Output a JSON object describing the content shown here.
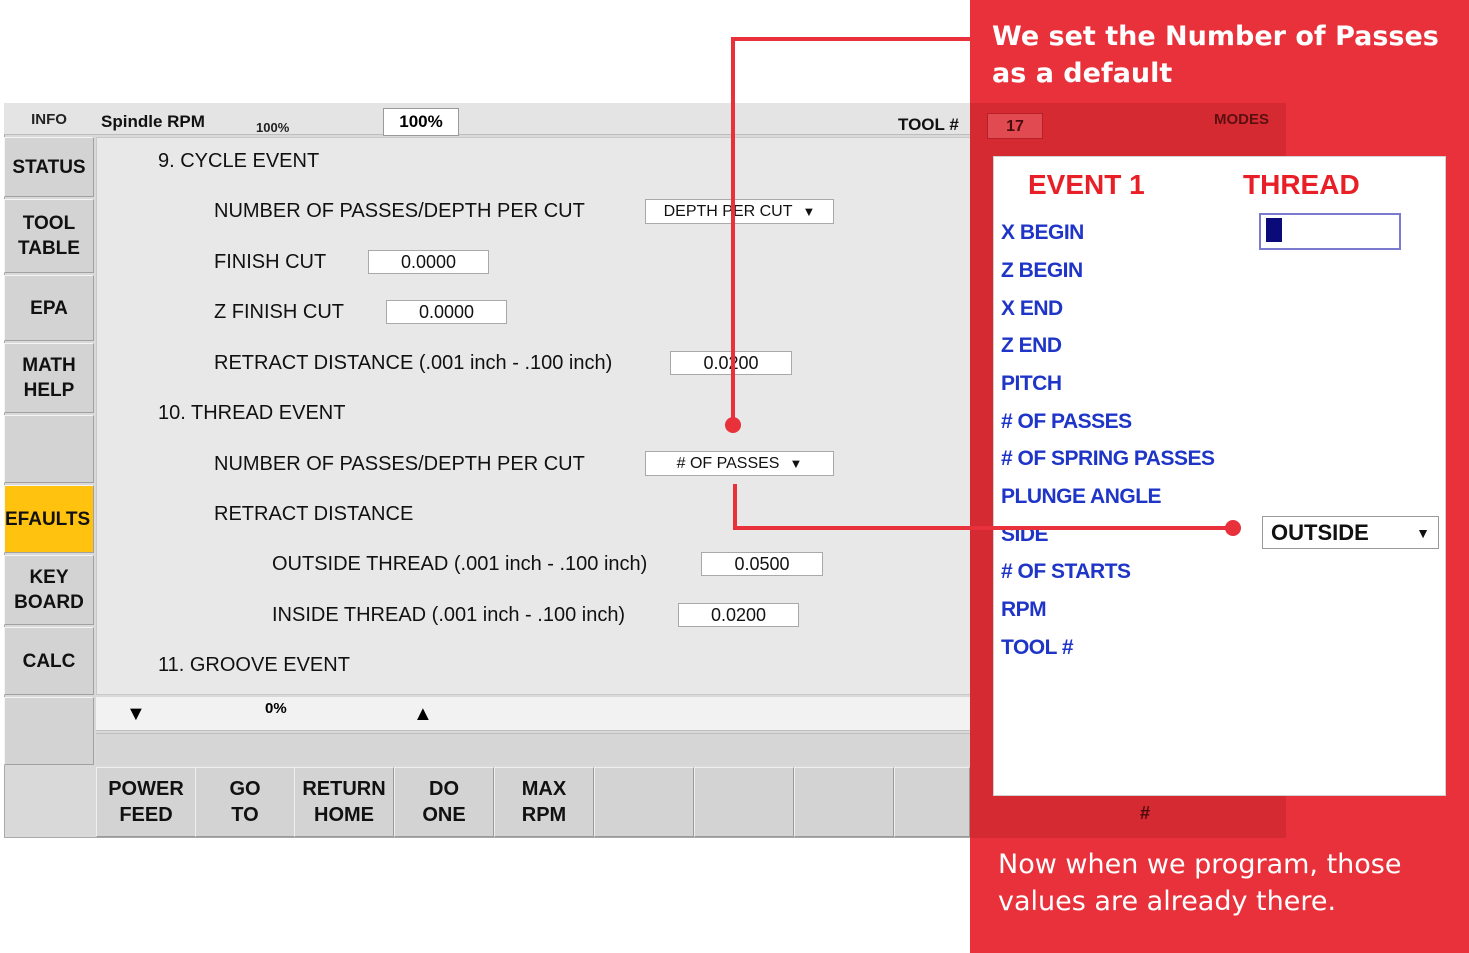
{
  "topbar": {
    "info": "INFO",
    "spindle_label": "Spindle RPM",
    "spindle_pct_small": "100%",
    "spindle_pct_box": "100%",
    "tool_label": "TOOL #",
    "tool_value": "17",
    "modes": "MODES"
  },
  "sidebar": [
    {
      "label": "STATUS"
    },
    {
      "label": "TOOL\nTABLE"
    },
    {
      "label": "EPA"
    },
    {
      "label": "MATH\nHELP"
    },
    {
      "label": ""
    },
    {
      "label": "EFAULTS",
      "active": true
    },
    {
      "label": "KEY\nBOARD"
    },
    {
      "label": "CALC"
    },
    {
      "label": ""
    }
  ],
  "defaults": {
    "cycle_header": "9.  CYCLE EVENT",
    "cycle_passes_label": "NUMBER OF PASSES/DEPTH PER CUT",
    "cycle_passes_value": "DEPTH PER CUT",
    "finish_cut_label": "FINISH CUT",
    "finish_cut_value": "0.0000",
    "z_finish_label": "Z FINISH CUT",
    "z_finish_value": "0.0000",
    "retract_label": "RETRACT DISTANCE  (.001 inch - .100 inch)",
    "retract_value": "0.0200",
    "thread_header": "10. THREAD EVENT",
    "thread_passes_label": "NUMBER OF PASSES/DEPTH PER CUT",
    "thread_passes_value": "# OF PASSES",
    "thread_retract_label": "RETRACT DISTANCE",
    "outside_label": "OUTSIDE THREAD  (.001 inch - .100 inch)",
    "outside_value": "0.0500",
    "inside_label": "INSIDE THREAD  (.001 inch - .100 inch)",
    "inside_value": "0.0200",
    "groove_header": "11. GROOVE EVENT"
  },
  "lower": {
    "feed_pct": "0%",
    "down_arrow": "▼",
    "up_arrow": "▲"
  },
  "fkeys": [
    "POWER\nFEED",
    "GO\nTO",
    "RETURN\nHOME",
    "DO\nONE",
    "MAX\nRPM",
    "",
    "",
    "",
    "",
    ""
  ],
  "callout": {
    "top": "We set the Number of Passes as a default",
    "bottom": "Now when we program, those values are already there.",
    "hash": "#"
  },
  "event_card": {
    "event": "EVENT 1",
    "type": "THREAD",
    "fields": [
      "X BEGIN",
      "Z BEGIN",
      "X END",
      "Z END",
      "PITCH",
      "# OF PASSES",
      "# OF SPRING PASSES",
      "PLUNGE ANGLE",
      "SIDE",
      "# OF STARTS",
      "RPM",
      "TOOL #"
    ],
    "side_value": "OUTSIDE",
    "colors": {
      "title": "#e81f26",
      "field": "#1f35c8",
      "callout": "#e8313b"
    }
  }
}
